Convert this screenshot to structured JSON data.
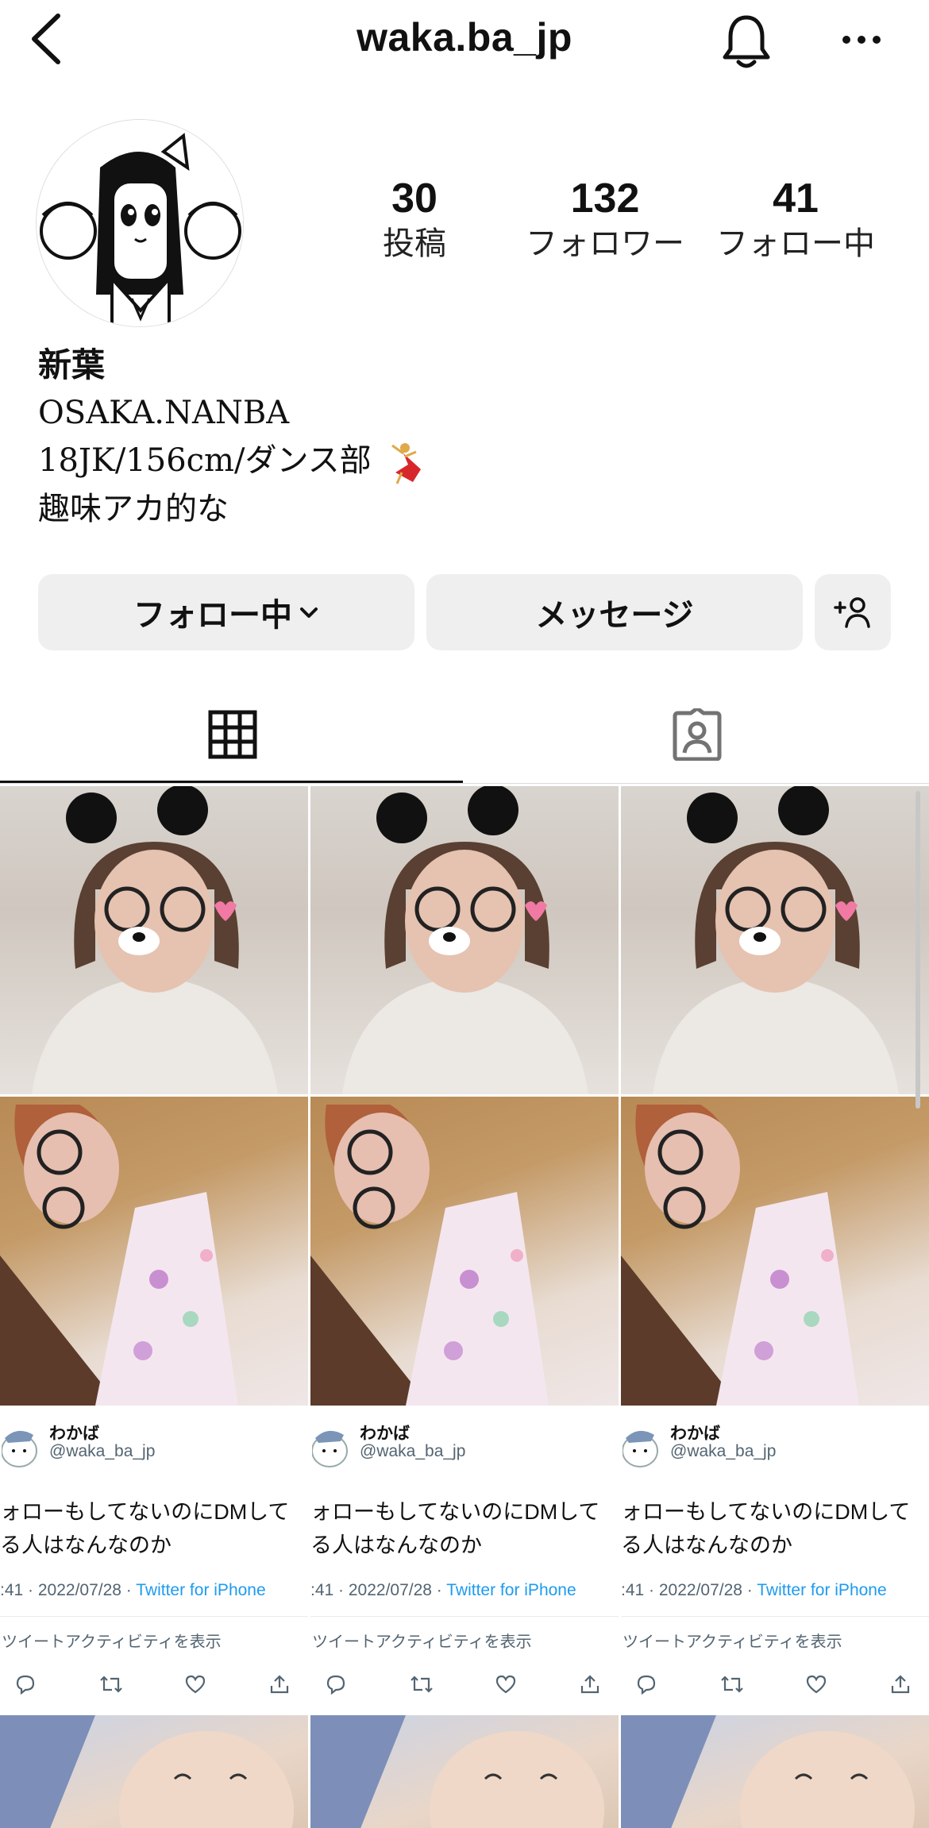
{
  "header": {
    "username": "waka.ba_jp",
    "back_icon": "chevron-left-icon",
    "bell_icon": "bell-icon",
    "more_icon": "more-horizontal-icon"
  },
  "profile": {
    "stats": [
      {
        "value": "30",
        "label": "投稿"
      },
      {
        "value": "132",
        "label": "フォロワー"
      },
      {
        "value": "41",
        "label": "フォロー中"
      }
    ],
    "display_name": "新葉",
    "bio_lines": [
      "OSAKA.NANBA",
      "18JK/156cm/ダンス部",
      "趣味アカ的な"
    ],
    "bio_emoji_icon": "dancer-icon"
  },
  "actions": {
    "follow_label": "フォロー中",
    "message_label": "メッセージ",
    "add_user_icon": "add-user-icon"
  },
  "tabs": {
    "grid_icon": "grid-icon",
    "tagged_icon": "tagged-user-icon",
    "active": "grid"
  },
  "tweet": {
    "name": "わかば",
    "handle": "@waka_ba_jp",
    "text_line1": "ォローもしてないのにDMして",
    "text_line2": "る人はなんなのか",
    "meta_time": ":41 · 2022/07/28 · ",
    "meta_source": "Twitter for iPhone",
    "activity": "ツイートアクティビティを表示"
  },
  "colors": {
    "button_bg": "#efefef",
    "twitter_blue": "#1d9bf0",
    "tab_indicator": "#111111"
  }
}
